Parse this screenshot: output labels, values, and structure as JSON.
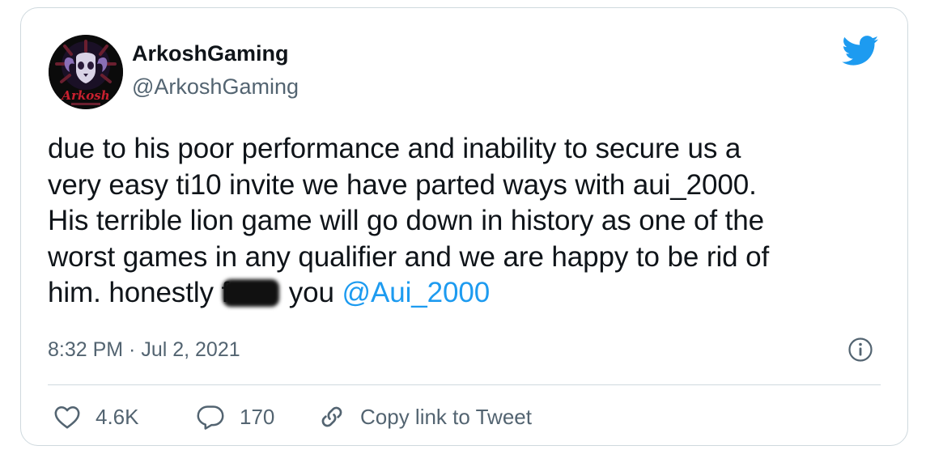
{
  "author": {
    "display_name": "ArkoshGaming",
    "handle": "@ArkoshGaming",
    "avatar_text": "Arkosh"
  },
  "tweet": {
    "lines": [
      "due to his poor performance and inability to secure us a",
      "very easy ti10 invite we have parted ways with aui_2000.",
      "His terrible lion game will go down in history as one of the",
      "worst games in any qualifier and we are happy to be rid of"
    ],
    "last_line_start": "him. honestly f",
    "last_line_after_censor": " you ",
    "mention": "@Aui_2000",
    "timestamp": "8:32 PM · Jul 2, 2021"
  },
  "actions": {
    "like_count": "4.6K",
    "reply_count": "170",
    "copy_link_label": "Copy link to Tweet"
  },
  "colors": {
    "accent": "#1d9bf0",
    "text": "#0f1419",
    "secondary": "#536471",
    "border": "#cfd9de"
  },
  "icons": [
    "twitter-bird-icon",
    "info-icon",
    "heart-icon",
    "reply-bubble-icon",
    "link-icon"
  ]
}
